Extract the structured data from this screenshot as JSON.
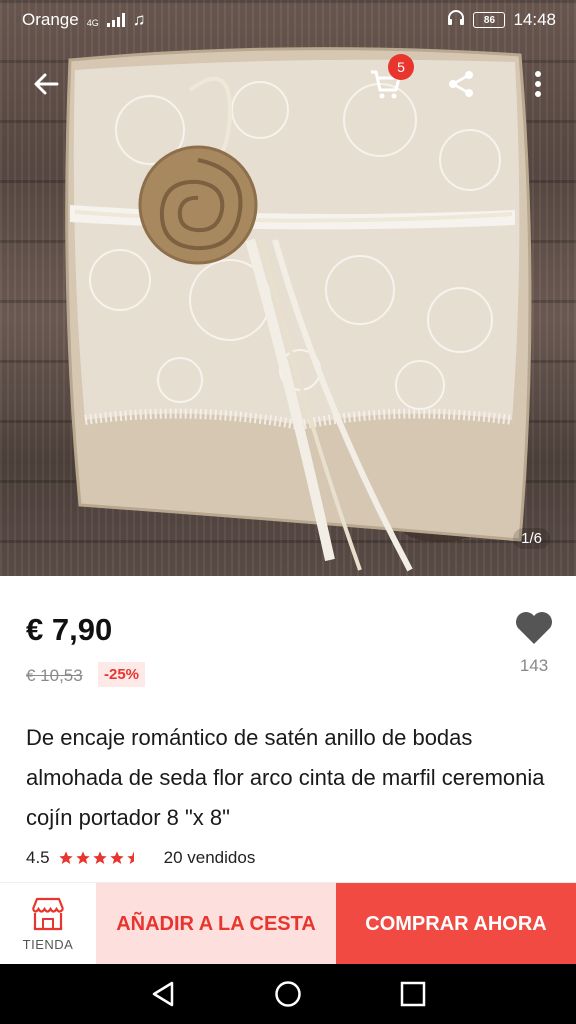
{
  "status_bar": {
    "carrier": "Orange",
    "network": "4G",
    "battery": "86",
    "time": "14:48"
  },
  "toolbar": {
    "cart_count": "5",
    "icons": [
      "back-arrow-icon",
      "cart-icon",
      "share-icon",
      "more-vert-icon"
    ]
  },
  "gallery": {
    "counter": "1/6"
  },
  "product": {
    "price": "€ 7,90",
    "old_price": "€ 10,53",
    "discount": "-25%",
    "wishlist_count": "143",
    "title": "De encaje romántico de satén anillo de bodas almohada de seda flor arco cinta de marfil ceremonia cojín portador 8 \"x 8\"",
    "rating": "4.5",
    "rating_value": 4.5,
    "sold": "20 vendidos"
  },
  "actions": {
    "store_label": "TIENDA",
    "add_to_cart": "AÑADIR A LA CESTA",
    "buy_now": "COMPRAR AHORA"
  },
  "colors": {
    "accent": "#e8352d",
    "buy_button": "#f04a43",
    "add_button_bg": "#fde0dd",
    "star": "#e8352d"
  }
}
